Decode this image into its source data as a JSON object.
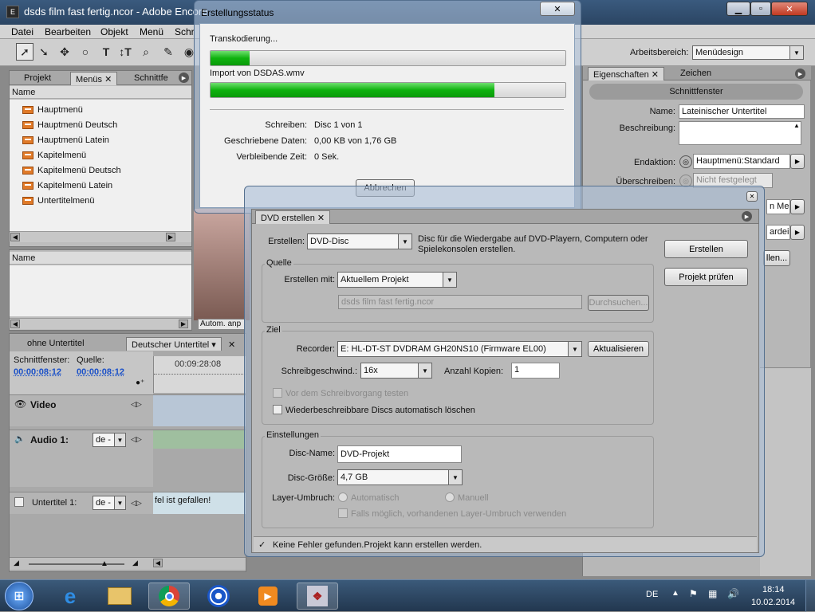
{
  "app": {
    "title": "dsds film fast fertig.ncor - Adobe Encore"
  },
  "menubar": [
    "Datei",
    "Bearbeiten",
    "Objekt",
    "Menü",
    "Schr"
  ],
  "workspace": {
    "label": "Arbeitsbereich:",
    "value": "Menüdesign"
  },
  "left_panel": {
    "tabs": [
      "Projekt",
      "Menüs",
      "Schnittfe"
    ],
    "column_name": "Name",
    "items": [
      "Hauptmenü",
      "Hauptmenü Deutsch",
      "Hauptmenü Latein",
      "Kapitelmenü",
      "Kapitelmenü Deutsch",
      "Kapitelmenü Latein",
      "Untertitelmenü"
    ],
    "bottom_column_name": "Name"
  },
  "preview": {
    "autom": "Autom. anp"
  },
  "timeline": {
    "tabs": [
      "ohne Untertitel",
      "Deutscher Untertitel"
    ],
    "schnittfenster_label": "Schnittfenster:",
    "quelle_label": "Quelle:",
    "schnittfenster_tc": "00:00:08:12",
    "quelle_tc": "00:00:08:12",
    "ruler_tc": "00:09:28:08",
    "video_label": "Video",
    "audio_label": "Audio 1:",
    "audio_lang": "de -",
    "subtitle_label": "Untertitel 1:",
    "subtitle_lang": "de -",
    "subtitle_text": "fel ist gefallen!"
  },
  "properties": {
    "tabs": [
      "Eigenschaften",
      "Zeichen"
    ],
    "header": "Schnittfenster",
    "name_label": "Name:",
    "name_value": "Lateinischer Untertitel",
    "beschreibung_label": "Beschreibung:",
    "endaktion_label": "Endaktion:",
    "endaktion_value": "Hauptmenü:Standard",
    "ueberschreiben_label": "Überschreiben:",
    "ueberschreiben_value": "Nicht festgelegt",
    "partial_1": "n Mer",
    "partial_2": "ardeir",
    "partial_3": "llen..."
  },
  "status_dialog": {
    "title": "Erstellungsstatus",
    "task": "Transkodierung...",
    "task_progress": 0.11,
    "import_label": "Import von DSDAS.wmv",
    "import_progress": 0.8,
    "schreiben_label": "Schreiben:",
    "schreiben_value": "Disc 1 von 1",
    "daten_label": "Geschriebene Daten:",
    "daten_value": "0,00 KB von 1,76 GB",
    "zeit_label": "Verbleibende Zeit:",
    "zeit_value": "0 Sek.",
    "cancel": "Abbrechen"
  },
  "dvd_dialog": {
    "tab": "DVD erstellen",
    "erstellen_label": "Erstellen:",
    "erstellen_value": "DVD-Disc",
    "erstellen_desc": "Disc für die Wiedergabe auf DVD-Playern, Computern oder Spielekonsolen erstellen.",
    "btn_erstellen": "Erstellen",
    "btn_pruefen": "Projekt prüfen",
    "quelle_group": "Quelle",
    "erstellen_mit_label": "Erstellen mit:",
    "erstellen_mit_value": "Aktuellem Projekt",
    "source_path": "dsds film fast fertig.ncor",
    "browse": "Durchsuchen...",
    "ziel_group": "Ziel",
    "recorder_label": "Recorder:",
    "recorder_value": "E: HL-DT-ST DVDRAM GH20NS10 (Firmware EL00)",
    "refresh": "Aktualisieren",
    "speed_label": "Schreibgeschwind.:",
    "speed_value": "16x",
    "copies_label": "Anzahl Kopien:",
    "copies_value": "1",
    "test_label": "Vor dem Schreibvorgang testen",
    "erase_label": "Wiederbeschreibbare Discs automatisch löschen",
    "einstellungen_group": "Einstellungen",
    "discname_label": "Disc-Name:",
    "discname_value": "DVD-Projekt",
    "discsize_label": "Disc-Größe:",
    "discsize_value": "4,7 GB",
    "layer_label": "Layer-Umbruch:",
    "auto_label": "Automatisch",
    "manual_label": "Manuell",
    "layer_check_label": "Falls möglich, vorhandenen Layer-Umbruch verwenden",
    "status": "Keine Fehler gefunden.Projekt kann erstellen werden."
  },
  "taskbar": {
    "lang": "DE",
    "time": "18:14",
    "date": "10.02.2014"
  },
  "colors": {
    "progress": "#11b311",
    "timecode": "#1a50c8",
    "taskbar": "#2b4563"
  }
}
